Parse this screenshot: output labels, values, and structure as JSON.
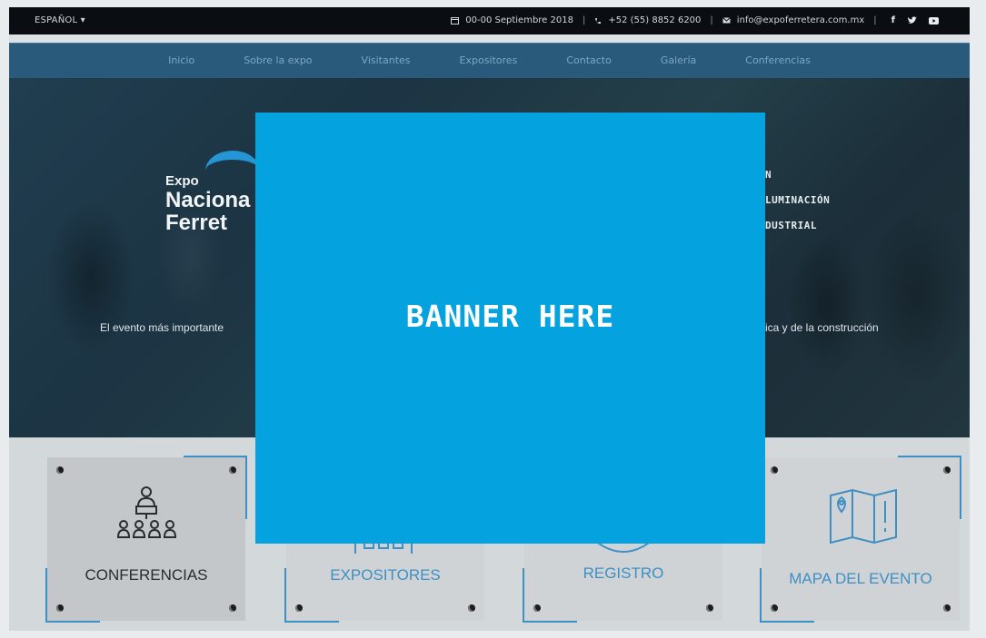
{
  "topbar": {
    "language": "ESPAÑOL ▾",
    "date": "00-00 Septiembre 2018",
    "phone": "+52 (55) 8852 6200",
    "email": "info@expoferretera.com.mx",
    "separator": "|",
    "social": [
      "f",
      "t",
      "y"
    ]
  },
  "nav": {
    "items": [
      "Inicio",
      "Sobre la expo",
      "Visitantes",
      "Expositores",
      "Contacto",
      "Galería",
      "Conferencias"
    ]
  },
  "hero": {
    "logo_line1": "Expo",
    "logo_line2": "Naciona",
    "logo_line3": "Ferret",
    "categories": [
      "N",
      "LUMINACIÓN",
      "DUSTRIAL"
    ],
    "tagline_left": "El evento más importante",
    "tagline_right": "rica y de la construcción"
  },
  "cards": [
    {
      "label": "CONFERENCIAS",
      "icon": "speaker-audience-icon"
    },
    {
      "label": "EXPOSITORES",
      "icon": "booth-icon"
    },
    {
      "label": "REGISTRO",
      "icon": "register-icon"
    },
    {
      "label": "MAPA DEL EVENTO",
      "icon": "map-icon"
    }
  ],
  "banner": {
    "text": "BANNER HERE"
  },
  "colors": {
    "banner": "#04a3df",
    "accent": "#3d8fc4",
    "nav": "#2a5a7b",
    "topbar": "#0a0d12"
  }
}
